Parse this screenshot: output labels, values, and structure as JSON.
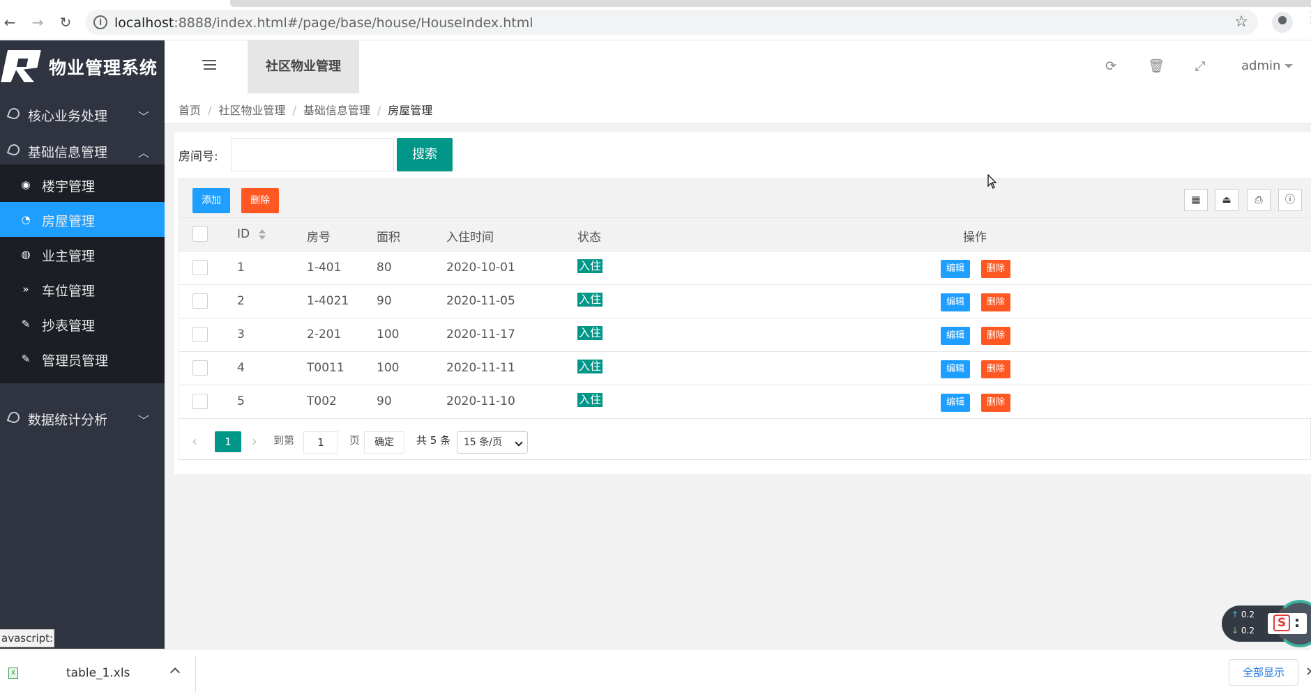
{
  "browser": {
    "url_host": "localhost",
    "url_rest": ":8888/index.html#/page/base/house/HouseIndex.html"
  },
  "sidebar": {
    "app_title": "物业管理系统",
    "groups": [
      {
        "label": "核心业务处理",
        "expanded": false
      },
      {
        "label": "基础信息管理",
        "expanded": true
      },
      {
        "label": "数据统计分析",
        "expanded": false
      }
    ],
    "sub_items": [
      {
        "label": "楼宇管理",
        "icon": "target-icon"
      },
      {
        "label": "房屋管理",
        "icon": "circle-icon",
        "active": true
      },
      {
        "label": "业主管理",
        "icon": "dashboard-icon"
      },
      {
        "label": "车位管理",
        "icon": "double-chevron-down-icon"
      },
      {
        "label": "抄表管理",
        "icon": "edit-icon"
      },
      {
        "label": "管理员管理",
        "icon": "edit-icon"
      }
    ]
  },
  "header": {
    "tab_label": "社区物业管理",
    "user": "admin"
  },
  "breadcrumb": [
    "首页",
    "社区物业管理",
    "基础信息管理",
    "房屋管理"
  ],
  "search": {
    "label": "房间号:",
    "value": "",
    "button": "搜索"
  },
  "toolbar": {
    "add": "添加",
    "delete": "删除"
  },
  "table": {
    "columns": [
      "ID",
      "房号",
      "面积",
      "入住时间",
      "状态",
      "操作"
    ],
    "rows": [
      {
        "id": "1",
        "room": "1-401",
        "area": "80",
        "date": "2020-10-01",
        "status": "入住"
      },
      {
        "id": "2",
        "room": "1-4021",
        "area": "90",
        "date": "2020-11-05",
        "status": "入住"
      },
      {
        "id": "3",
        "room": "2-201",
        "area": "100",
        "date": "2020-11-17",
        "status": "入住"
      },
      {
        "id": "4",
        "room": "T0011",
        "area": "100",
        "date": "2020-11-11",
        "status": "入住"
      },
      {
        "id": "5",
        "room": "T002",
        "area": "90",
        "date": "2020-11-10",
        "status": "入住"
      }
    ],
    "edit_label": "编辑",
    "delete_label": "删除"
  },
  "pager": {
    "current": "1",
    "goto_label": "到第",
    "goto_value": "1",
    "page_label": "页",
    "ok": "确定",
    "total": "共 5 条",
    "page_size": "15 条/页"
  },
  "status_url": "avascript:;",
  "speed": {
    "up": "0.2",
    "down": "0.2"
  },
  "download": {
    "filename": "table_1.xls",
    "show_all": "全部显示"
  },
  "colors": {
    "sidebar_bg": "#2f3440",
    "active_blue": "#1e9fff",
    "primary_green": "#009688",
    "danger_orange": "#ff5722"
  }
}
